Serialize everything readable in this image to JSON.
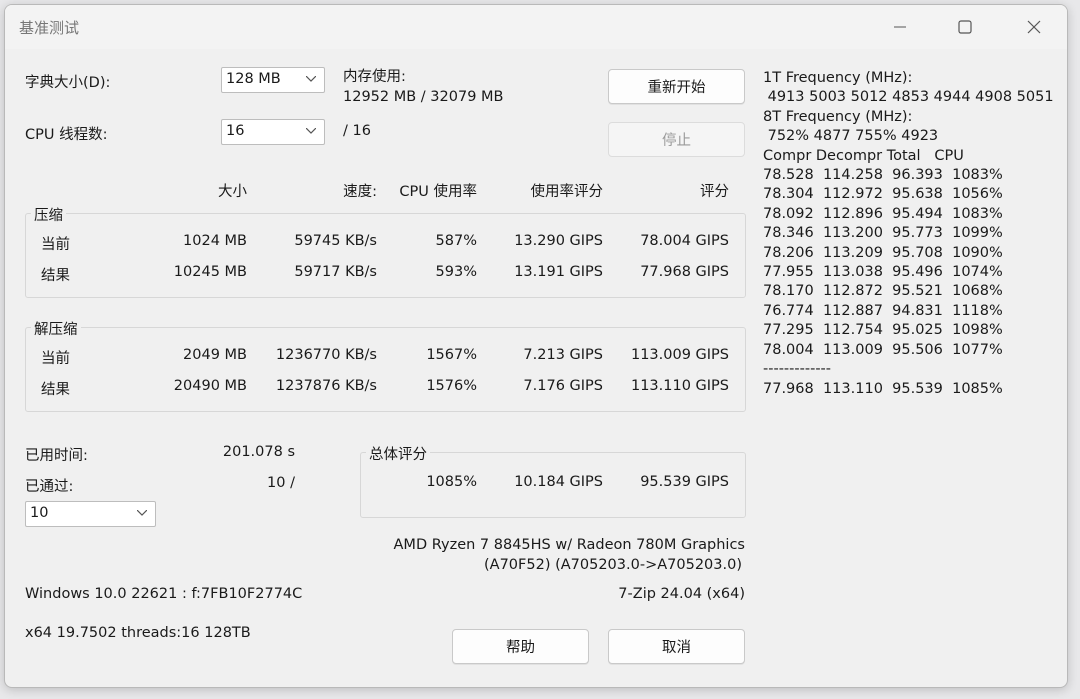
{
  "window": {
    "title": "基准测试",
    "minimize_glyph": "—",
    "maximize_glyph": "□",
    "close_glyph": "✕"
  },
  "settings": {
    "dict_label": "字典大小(D):",
    "dict_value": "128 MB",
    "threads_label": "CPU 线程数:",
    "threads_value": "16",
    "threads_max": "/ 16",
    "mem_label": "内存使用:",
    "mem_value": "12952 MB / 32079 MB"
  },
  "buttons": {
    "restart": "重新开始",
    "stop": "停止",
    "help": "帮助",
    "cancel": "取消"
  },
  "columns": {
    "size": "大小",
    "speed": "速度:",
    "cpu_usage": "CPU 使用率",
    "usage_rating": "使用率评分",
    "rating": "评分"
  },
  "compress": {
    "label": "压缩",
    "rows": [
      {
        "name": "当前",
        "size": "1024 MB",
        "speed": "59745 KB/s",
        "cpu": "587%",
        "usage": "13.290 GIPS",
        "rating": "78.004 GIPS"
      },
      {
        "name": "结果",
        "size": "10245 MB",
        "speed": "59717 KB/s",
        "cpu": "593%",
        "usage": "13.191 GIPS",
        "rating": "77.968 GIPS"
      }
    ]
  },
  "decompress": {
    "label": "解压缩",
    "rows": [
      {
        "name": "当前",
        "size": "2049 MB",
        "speed": "1236770 KB/s",
        "cpu": "1567%",
        "usage": "7.213 GIPS",
        "rating": "113.009 GIPS"
      },
      {
        "name": "结果",
        "size": "20490 MB",
        "speed": "1237876 KB/s",
        "cpu": "1576%",
        "usage": "7.176 GIPS",
        "rating": "113.110 GIPS"
      }
    ]
  },
  "status": {
    "elapsed_label": "已用时间:",
    "elapsed_value": "201.078 s",
    "passes_label": "已通过:",
    "passes_value": "10 /",
    "passes_select": "10"
  },
  "total": {
    "label": "总体评分",
    "cpu": "1085%",
    "usage": "10.184 GIPS",
    "rating": "95.539 GIPS"
  },
  "system": {
    "cpu_name": "AMD Ryzen 7 8845HS w/ Radeon 780M Graphics",
    "cpu_id": "(A70F52) (A705203.0->A705203.0)",
    "os": "Windows 10.0 22621 : f:7FB10F2774C",
    "version": "7-Zip 24.04 (x64)",
    "arch": "x64 19.7502 threads:16 128TB"
  },
  "log": [
    "1T Frequency (MHz):",
    " 4913 5003 5012 4853 4944 4908 5051",
    "8T Frequency (MHz):",
    " 752% 4877 755% 4923",
    "Compr Decompr Total   CPU",
    "78.528  114.258  96.393  1083%",
    "78.304  112.972  95.638  1056%",
    "78.092  112.896  95.494  1083%",
    "78.346  113.200  95.773  1099%",
    "78.206  113.209  95.708  1090%",
    "77.955  113.038  95.496  1074%",
    "78.170  112.872  95.521  1068%",
    "76.774  112.887  94.831  1118%",
    "77.295  112.754  95.025  1098%",
    "78.004  113.009  95.506  1077%",
    "-------------",
    "77.968  113.110  95.539  1085%"
  ]
}
